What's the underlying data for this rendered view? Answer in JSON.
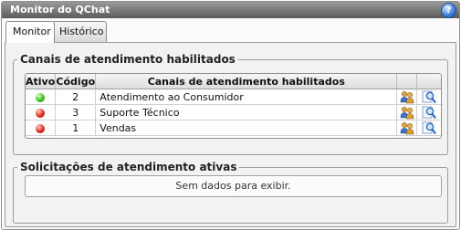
{
  "window": {
    "title": "Monitor do QChat",
    "help_icon": "help-icon",
    "help_glyph": "?"
  },
  "tabs": [
    {
      "label": "Monitor",
      "active": true
    },
    {
      "label": "Histórico",
      "active": false
    }
  ],
  "channels_section": {
    "legend": "Canais de atendimento habilitados",
    "columns": {
      "active": "Ativo",
      "code": "Código",
      "name": "Canais de atendimento habilitados"
    },
    "rows": [
      {
        "status": "green",
        "code": "2",
        "name": "Atendimento ao Consumidor"
      },
      {
        "status": "red",
        "code": "3",
        "name": "Suporte Técnico"
      },
      {
        "status": "red",
        "code": "1",
        "name": "Vendas"
      }
    ]
  },
  "requests_section": {
    "legend": "Solicitações de atendimento ativas",
    "empty_text": "Sem dados para exibir."
  },
  "colors": {
    "status_green": "#3cc01e",
    "status_red": "#e3291b",
    "titlebar": "#6f6f6f"
  }
}
